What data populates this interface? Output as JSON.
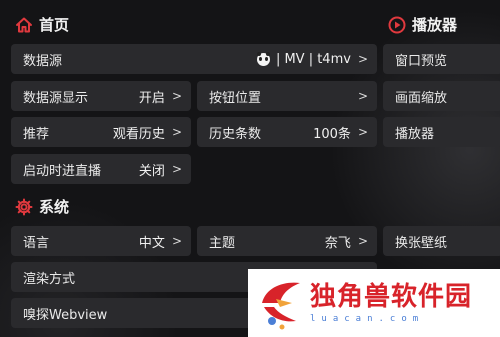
{
  "sections": {
    "home": {
      "title": "首页",
      "icon": "home-icon"
    },
    "player": {
      "title": "播放器",
      "icon": "play-circle-icon"
    },
    "system": {
      "title": "系统",
      "icon": "gear-icon"
    }
  },
  "home": {
    "data_source": {
      "label": "数据源",
      "value": "| MV | t4mv",
      "icon": "panda-icon"
    },
    "data_source_display": {
      "label": "数据源显示",
      "value": "开启"
    },
    "button_position": {
      "label": "按钮位置",
      "value": ""
    },
    "recommend": {
      "label": "推荐",
      "value": "观看历史"
    },
    "history_count": {
      "label": "历史条数",
      "value": "100条"
    },
    "startup_live": {
      "label": "启动时进直播",
      "value": "关闭"
    }
  },
  "player": {
    "window_preview": {
      "label": "窗口预览"
    },
    "picture_scale": {
      "label": "画面缩放"
    },
    "player": {
      "label": "播放器"
    }
  },
  "system": {
    "language": {
      "label": "语言",
      "value": "中文"
    },
    "theme": {
      "label": "主题",
      "value": "奈飞"
    },
    "wallpaper": {
      "label": "换张壁纸"
    },
    "render_mode": {
      "label": "渲染方式"
    },
    "sniff_webview": {
      "label": "嗅探Webview"
    }
  },
  "chevron": ">",
  "watermark": {
    "main": "独角兽软件园",
    "sub": "luacan.com"
  },
  "colors": {
    "accent": "#e0393e",
    "cell_bg": "#2a2a2d",
    "page_bg": "#141416"
  }
}
